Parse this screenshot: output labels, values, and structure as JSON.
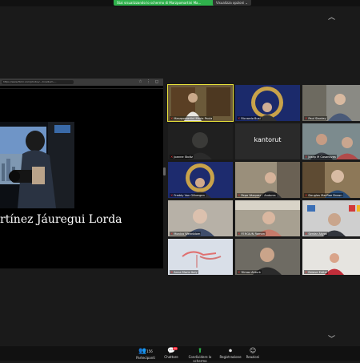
{
  "top": {
    "share_banner": "Stai visualizzando lo schermo di Marzpomartini Ma...",
    "view_options": "Visualizza opzioni ⌄"
  },
  "shared_screen": {
    "url": "https://www.flickr.com/photos/.../in/album-...",
    "slide_title": "rtínez Jáuregui Lorda"
  },
  "gallery": [
    {
      "name": "Marzpomartini Maria Paula",
      "muted": true,
      "active": true,
      "bg": "#6b5a3a"
    },
    {
      "name": "Riccardo Busi",
      "muted": true,
      "active": false,
      "bg": "#1b2a6b"
    },
    {
      "name": "Paul Stanley",
      "muted": true,
      "active": false,
      "bg": "#8a8a84"
    },
    {
      "name": "Joanne Stoltz",
      "muted": true,
      "active": false,
      "bg": "#202020"
    },
    {
      "name": "",
      "center": "kantorut",
      "muted": false,
      "active": false,
      "bg": "#242424"
    },
    {
      "name": "Josep M Casanovas",
      "muted": true,
      "active": false,
      "bg": "#7c8b8e"
    },
    {
      "name": "Freddy Van Gilbergen",
      "muted": true,
      "active": false,
      "bg": "#1d2b6e"
    },
    {
      "name": "Pepo Vázquez – Andorra",
      "muted": true,
      "active": false,
      "bg": "#9a8f7b"
    },
    {
      "name": "Douglas MacRae Brown",
      "muted": true,
      "active": false,
      "bg": "#8d7858"
    },
    {
      "name": "Monica Wennblom",
      "muted": true,
      "active": false,
      "bg": "#b7b1a7"
    },
    {
      "name": "FERGIUN Roman",
      "muted": true,
      "active": false,
      "bg": "#a7a091"
    },
    {
      "name": "Serdar Akyav",
      "muted": true,
      "active": false,
      "bg": "#cfcfcf"
    },
    {
      "name": "Anna Maria Italy",
      "muted": true,
      "active": false,
      "bg": "#d9dfe8"
    },
    {
      "name": "Yilmaz Akturk",
      "muted": true,
      "active": false,
      "bg": "#6e6b63"
    },
    {
      "name": "Esteve Estter",
      "muted": true,
      "active": false,
      "bg": "#e6e4e0"
    }
  ],
  "toolbar": {
    "participants_count": "156",
    "participants_label": "Partecipanti",
    "chat_label": "Chattare",
    "chat_badge": "23",
    "share_label": "Condividere lo schermo",
    "record_label": "Registrazione",
    "reactions_label": "Reazioni"
  },
  "icons": [
    "chevron-up-icon",
    "chevron-down-icon",
    "participants-icon",
    "chat-icon",
    "share-screen-icon",
    "record-icon",
    "reactions-icon"
  ]
}
